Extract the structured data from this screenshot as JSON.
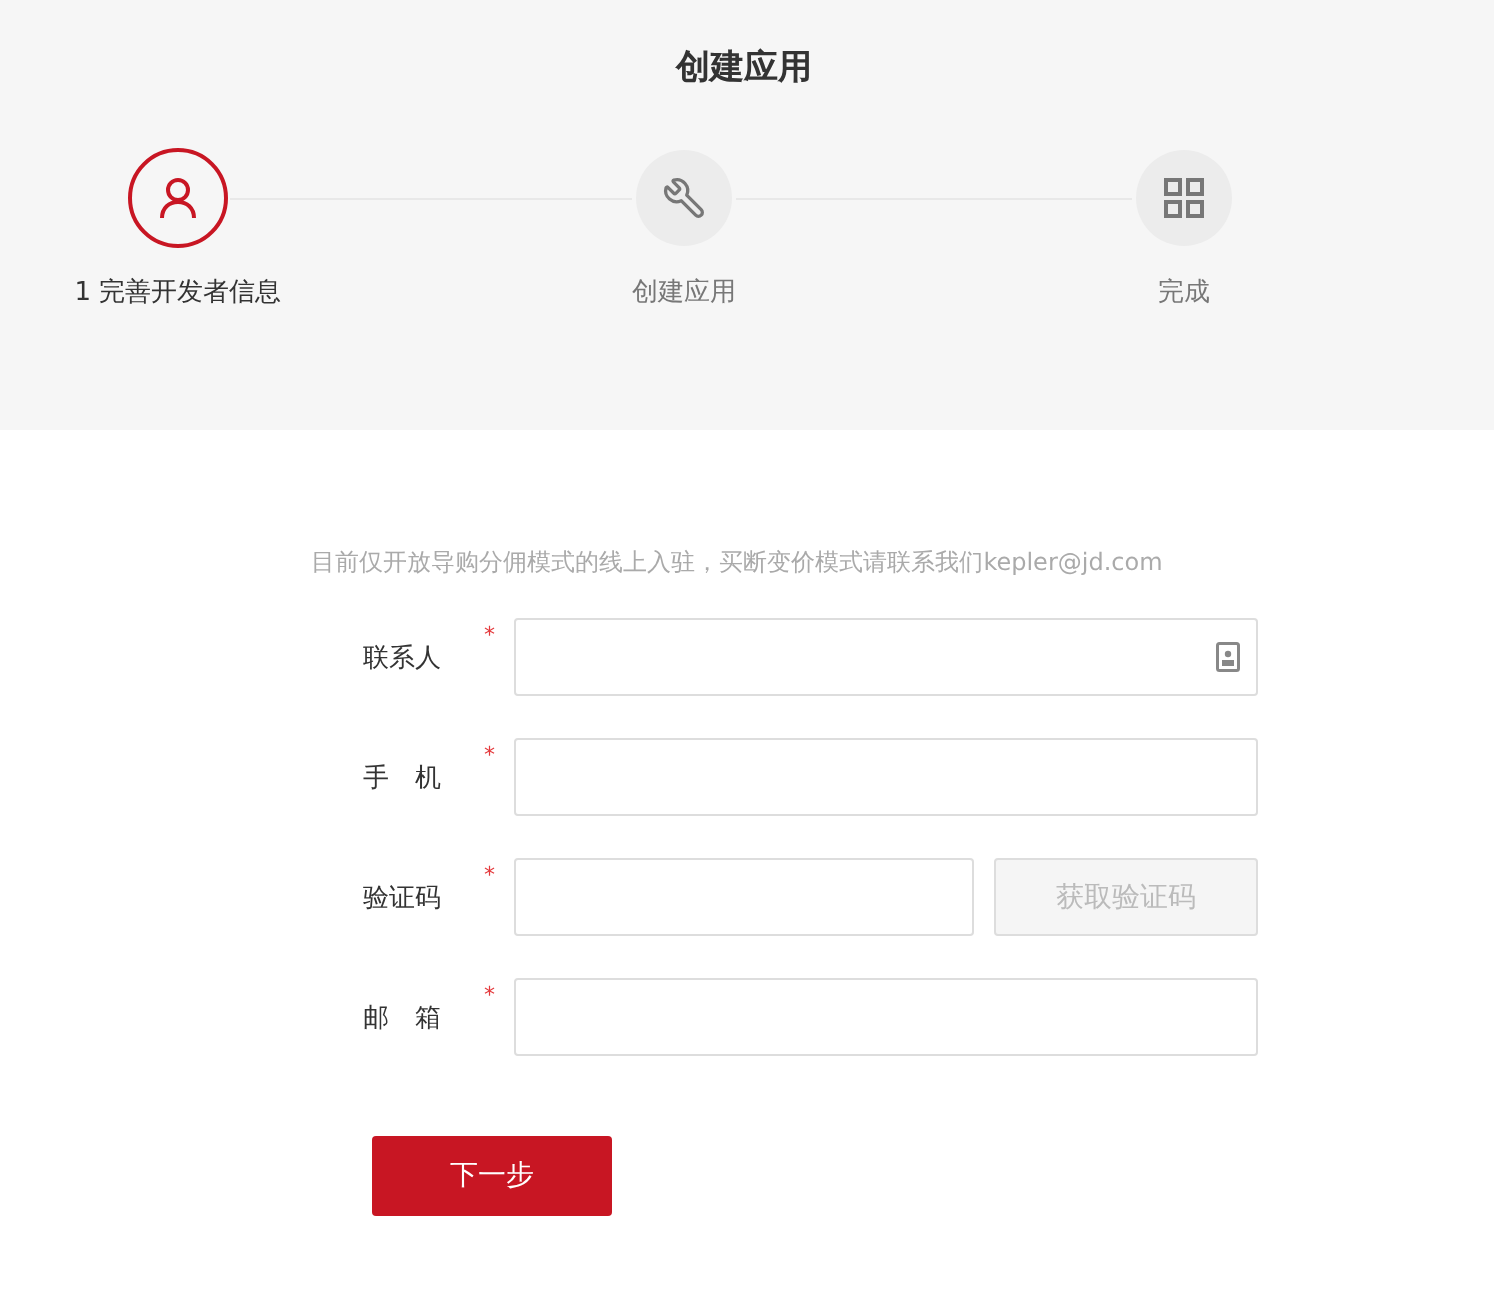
{
  "title": "创建应用",
  "steps": [
    {
      "label": "1 完善开发者信息",
      "selected": true
    },
    {
      "label": "创建应用",
      "selected": false
    },
    {
      "label": "完成",
      "selected": false
    }
  ],
  "notice": "目前仅开放导购分佣模式的线上入驻，买断变价模式请联系我们kepler@jd.com",
  "fields": [
    {
      "label": "联系人",
      "mark": "*",
      "kind": "contact"
    },
    {
      "label": "手　机",
      "mark": "*",
      "kind": "text"
    },
    {
      "label": "验证码",
      "mark": "*",
      "kind": "code",
      "button": "获取验证码"
    },
    {
      "label": "邮　箱",
      "mark": "*",
      "kind": "text"
    }
  ],
  "submit": "下一步"
}
